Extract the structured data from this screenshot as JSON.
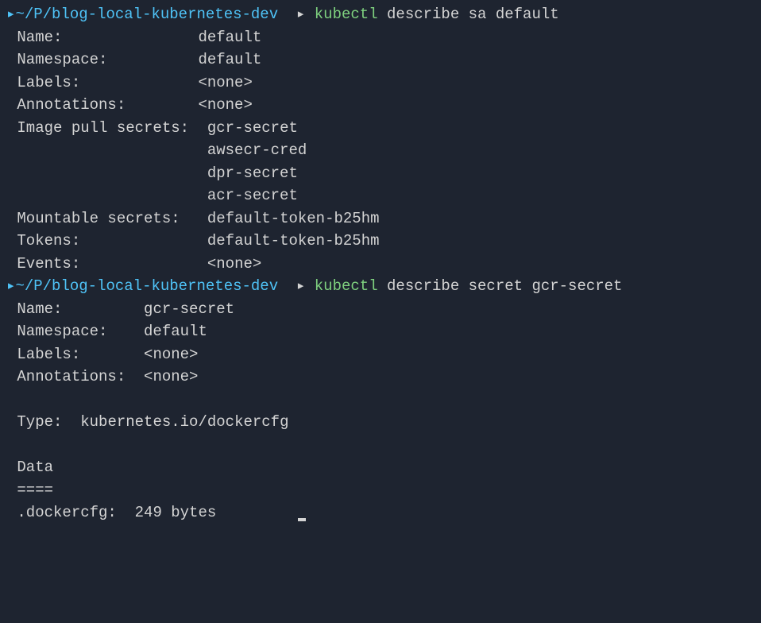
{
  "prompt1": {
    "arrow": "▸",
    "path": "~/P/blog-local-kubernetes-dev",
    "sep_arrow": "▸",
    "cmd": "kubectl",
    "args": "describe sa default"
  },
  "output1": {
    "name_label": " Name:",
    "name_value": "default",
    "namespace_label": " Namespace:",
    "namespace_value": "default",
    "labels_label": " Labels:",
    "labels_value": "<none>",
    "annotations_label": " Annotations:",
    "annotations_value": "<none>",
    "ips_label": " Image pull secrets:",
    "ips_value1": "gcr-secret",
    "ips_value2": "awsecr-cred",
    "ips_value3": "dpr-secret",
    "ips_value4": "acr-secret",
    "mountable_label": " Mountable secrets:",
    "mountable_value": "default-token-b25hm",
    "tokens_label": " Tokens:",
    "tokens_value": "default-token-b25hm",
    "events_label": " Events:",
    "events_value": "<none>"
  },
  "prompt2": {
    "arrow": "▸",
    "path": "~/P/blog-local-kubernetes-dev",
    "sep_arrow": "▸",
    "cmd": "kubectl",
    "args": "describe secret gcr-secret"
  },
  "output2": {
    "name_label": " Name:",
    "name_value": "gcr-secret",
    "namespace_label": " Namespace:",
    "namespace_value": "default",
    "labels_label": " Labels:",
    "labels_value": "<none>",
    "annotations_label": " Annotations:",
    "annotations_value": "<none>",
    "type_label": " Type:",
    "type_value": "kubernetes.io/dockercfg",
    "data_header": " Data",
    "data_sep": " ====",
    "dockercfg_label": " .dockercfg:",
    "dockercfg_value": "249 bytes"
  }
}
